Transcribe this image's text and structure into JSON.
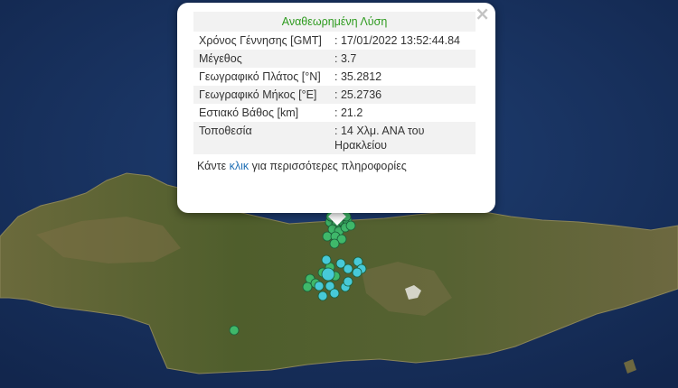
{
  "popup": {
    "title": "Αναθεωρημένη Λύση",
    "close_symbol": "×",
    "rows": [
      {
        "label": "Χρόνος Γέννησης [GMT]",
        "value": ": 17/01/2022 13:52:44.84"
      },
      {
        "label": "Μέγεθος",
        "value": ": 3.7"
      },
      {
        "label": "Γεωγραφικό Πλάτος [°N]",
        "value": ": 35.2812"
      },
      {
        "label": "Γεωγραφικό Μήκος [°E]",
        "value": ": 25.2736"
      },
      {
        "label": "Εστιακό Βάθος [km]",
        "value": ": 21.2"
      },
      {
        "label": "Τοποθεσία",
        "value": ": 14 Χλμ. ΑΝΑ του Ηρακλείου"
      }
    ],
    "more_prefix": "Κάντε",
    "more_link": "κλικ",
    "more_suffix": "για περισσότερες πληροφορίες"
  },
  "colors": {
    "title_green": "#2e9b1f",
    "link_blue": "#1f6fb5",
    "marker_green": "#3fb86a",
    "marker_cyan": "#47c9d8"
  },
  "markers": {
    "green_count": 22,
    "cyan_count": 13
  }
}
